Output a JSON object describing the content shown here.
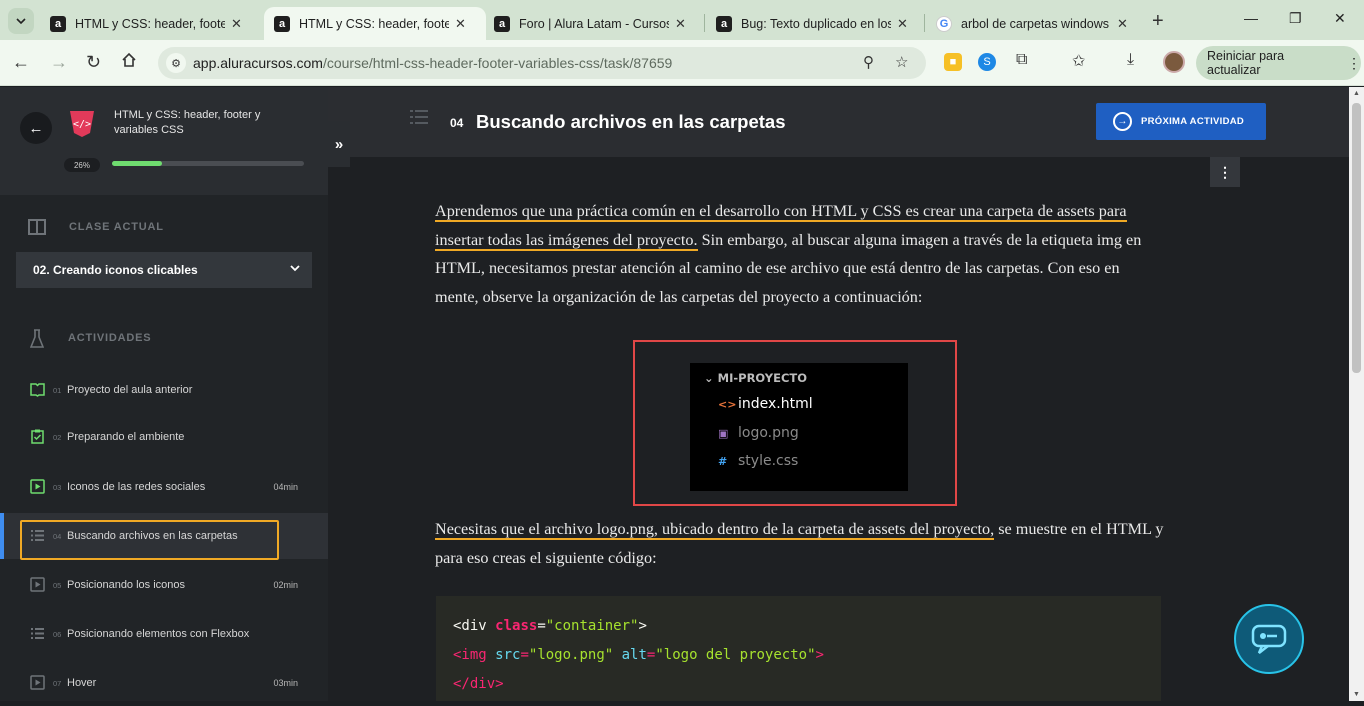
{
  "browser": {
    "tabs": [
      {
        "title": "HTML y CSS: header, footer y",
        "favicon": "a",
        "active": false
      },
      {
        "title": "HTML y CSS: header, footer y",
        "favicon": "a",
        "active": true
      },
      {
        "title": "Foro | Alura Latam - Cursos o",
        "favicon": "a",
        "active": false
      },
      {
        "title": "Bug: Texto duplicado en los c",
        "favicon": "a",
        "active": false
      },
      {
        "title": "arbol de carpetas windows - G",
        "favicon": "G",
        "active": false
      }
    ],
    "url_domain": "app.aluracursos.com",
    "url_path": "/course/html-css-header-footer-variables-css/task/87659",
    "restart_label": "Reiniciar para actualizar"
  },
  "sidebar": {
    "course_title": "HTML y CSS: header, footer y variables CSS",
    "progress_label": "26%",
    "progress_value": 0.26,
    "current_class_label": "CLASE ACTUAL",
    "current_class": "02. Creando iconos clicables",
    "activities_label": "ACTIVIDADES",
    "activities": [
      {
        "num": "01",
        "label": "Proyecto del aula anterior",
        "duration": "",
        "icon": "book-icon"
      },
      {
        "num": "02",
        "label": "Preparando el ambiente",
        "duration": "",
        "icon": "clipboard-check-icon"
      },
      {
        "num": "03",
        "label": "Iconos de las redes sociales",
        "duration": "04min",
        "icon": "video-icon"
      },
      {
        "num": "04",
        "label": "Buscando archivos en las carpetas",
        "duration": "",
        "icon": "list-icon"
      },
      {
        "num": "05",
        "label": "Posicionando los iconos",
        "duration": "02min",
        "icon": "video-icon"
      },
      {
        "num": "06",
        "label": "Posicionando elementos con Flexbox",
        "duration": "",
        "icon": "list-icon"
      },
      {
        "num": "07",
        "label": "Hover",
        "duration": "03min",
        "icon": "video-icon"
      }
    ]
  },
  "main": {
    "activity_num": "04",
    "activity_title": "Buscando archivos en las carpetas",
    "next_label": "PRÓXIMA ACTIVIDAD",
    "para1_underlined": "Aprendemos que una práctica común en el desarrollo con HTML y CSS es crear una carpeta de assets para insertar todas las imágenes del proyecto.",
    "para1_rest": " Sin embargo, al buscar alguna imagen a través de la etiqueta img en HTML, necesitamos prestar atención al camino de ese archivo que está dentro de las carpetas. Con eso en mente, observe la organización de las carpetas del proyecto a continuación:",
    "explorer": {
      "folder": "MI-PROYECTO",
      "files": [
        {
          "name": "index.html",
          "icon": "<>",
          "icon_color": "#e8743b",
          "text_color": "#ffffff"
        },
        {
          "name": "logo.png",
          "icon": "▣",
          "icon_color": "#a074c4",
          "text_color": "#8a8a8a"
        },
        {
          "name": "style.css",
          "icon": "#",
          "icon_color": "#42a5f5",
          "text_color": "#8a8a8a"
        }
      ]
    },
    "para2_underlined": "Necesitas que el archivo logo.png, ubicado dentro de la carpeta de assets del proyecto,",
    "para2_rest": " se muestre en el HTML y para eso creas el siguiente código:",
    "code": {
      "l1_open": "<div ",
      "l1_attr": "class",
      "l1_eq": "=",
      "l1_val": "\"container\"",
      "l1_close": ">",
      "l2_tag": "<img ",
      "l2_attr1": "src",
      "l2_eq1": "=",
      "l2_val1": "\"logo.png\"",
      "l2_attr2": "alt",
      "l2_eq2": "=",
      "l2_val2": "\"logo del proyecto\"",
      "l2_close": ">",
      "l3": "</div>"
    }
  }
}
